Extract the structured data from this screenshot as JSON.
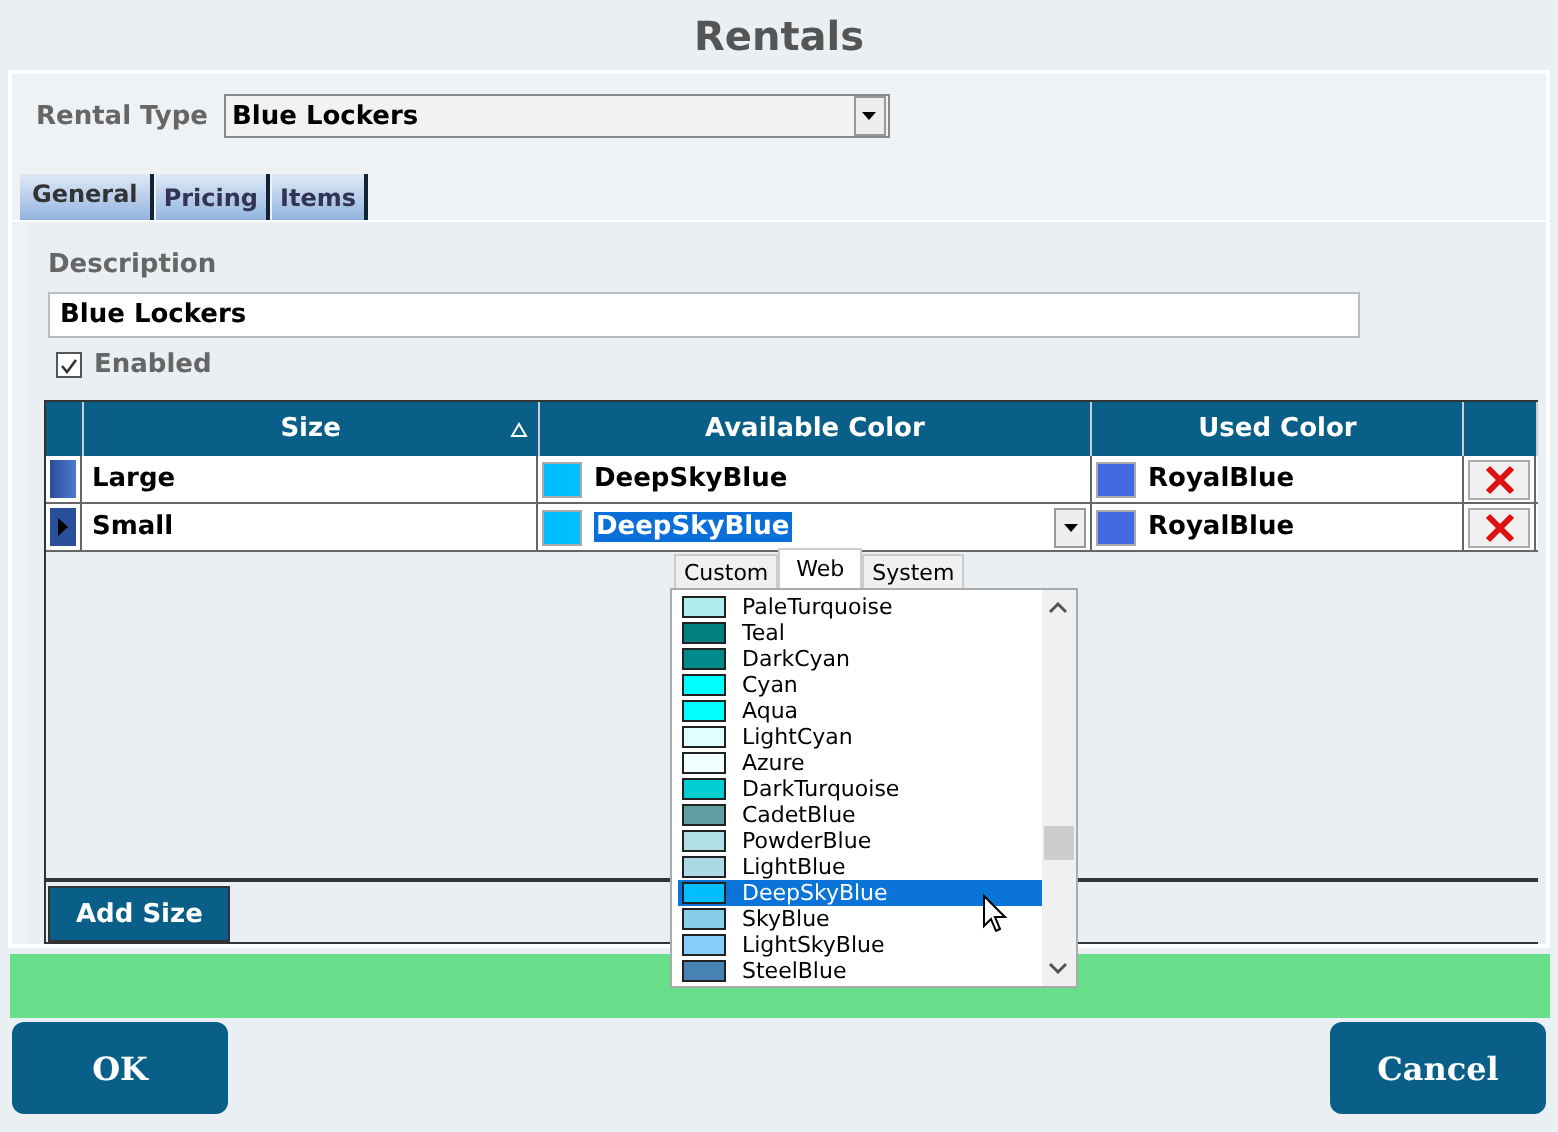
{
  "window": {
    "title": "Rentals"
  },
  "rental_type": {
    "label": "Rental Type",
    "value": "Blue Lockers"
  },
  "tabs": [
    {
      "label": "General",
      "selected": true
    },
    {
      "label": "Pricing",
      "selected": false
    },
    {
      "label": "Items",
      "selected": false
    }
  ],
  "description": {
    "label": "Description",
    "value": "Blue Lockers"
  },
  "enabled": {
    "label": "Enabled",
    "checked": true
  },
  "table": {
    "columns": [
      "Size",
      "Available Color",
      "Used Color"
    ],
    "rows": [
      {
        "size": "Large",
        "available": {
          "name": "DeepSkyBlue",
          "color": "#00bfff"
        },
        "used": {
          "name": "RoyalBlue",
          "color": "#4169e1"
        },
        "selected": false
      },
      {
        "size": "Small",
        "available": {
          "name": "DeepSkyBlue",
          "color": "#00bfff"
        },
        "used": {
          "name": "RoyalBlue",
          "color": "#4169e1"
        },
        "selected": true
      }
    ]
  },
  "color_picker": {
    "tabs": [
      {
        "label": "Custom",
        "selected": false
      },
      {
        "label": "Web",
        "selected": true
      },
      {
        "label": "System",
        "selected": false
      }
    ],
    "items": [
      {
        "name": "PaleTurquoise",
        "color": "#afeeee",
        "selected": false
      },
      {
        "name": "Teal",
        "color": "#008080",
        "selected": false
      },
      {
        "name": "DarkCyan",
        "color": "#008b8b",
        "selected": false
      },
      {
        "name": "Cyan",
        "color": "#00ffff",
        "selected": false
      },
      {
        "name": "Aqua",
        "color": "#00fffe",
        "selected": false
      },
      {
        "name": "LightCyan",
        "color": "#e0ffff",
        "selected": false
      },
      {
        "name": "Azure",
        "color": "#f0ffff",
        "selected": false
      },
      {
        "name": "DarkTurquoise",
        "color": "#00ced1",
        "selected": false
      },
      {
        "name": "CadetBlue",
        "color": "#5f9ea0",
        "selected": false
      },
      {
        "name": "PowderBlue",
        "color": "#b0e0e6",
        "selected": false
      },
      {
        "name": "LightBlue",
        "color": "#add8e6",
        "selected": false
      },
      {
        "name": "DeepSkyBlue",
        "color": "#00bfff",
        "selected": true
      },
      {
        "name": "SkyBlue",
        "color": "#87ceeb",
        "selected": false
      },
      {
        "name": "LightSkyBlue",
        "color": "#87cefa",
        "selected": false
      },
      {
        "name": "SteelBlue",
        "color": "#4682b4",
        "selected": false
      }
    ]
  },
  "add_button": "Add Size",
  "buttons": {
    "ok": "OK",
    "cancel": "Cancel"
  }
}
